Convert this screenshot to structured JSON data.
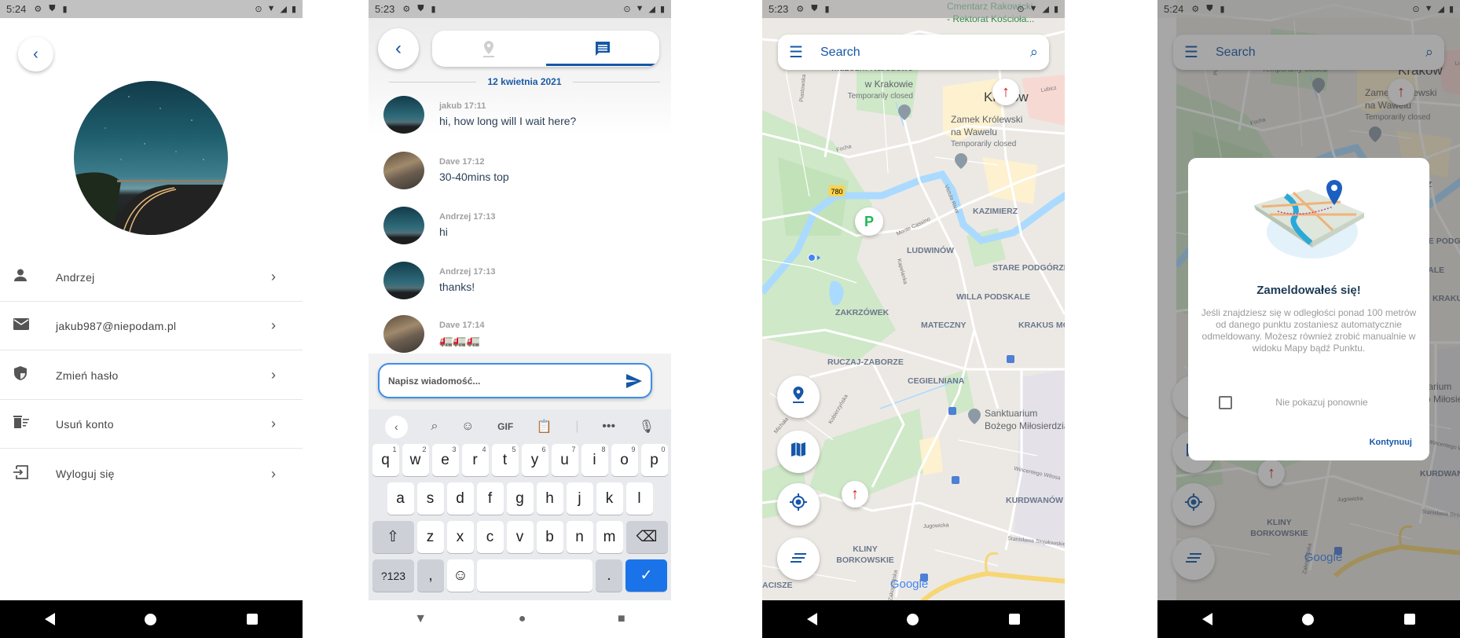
{
  "colors": {
    "accent": "#1557a8",
    "keyboard_enter": "#1a73e8",
    "compass": "#d01c1c",
    "parking": "#1db954"
  },
  "screens": [
    {
      "status": {
        "time": "5:24"
      }
    },
    {
      "status": {
        "time": "5:23"
      }
    },
    {
      "status": {
        "time": "5:23"
      }
    },
    {
      "status": {
        "time": "5:24"
      }
    }
  ],
  "profile": {
    "items": [
      {
        "icon": "person-icon",
        "label": "Andrzej"
      },
      {
        "icon": "email-icon",
        "label": "jakub987@niepodam.pl"
      },
      {
        "icon": "shield-icon",
        "label": "Zmień hasło"
      },
      {
        "icon": "delete-account-icon",
        "label": "Usuń konto"
      },
      {
        "icon": "logout-icon",
        "label": "Wyloguj się"
      }
    ]
  },
  "chat": {
    "tabs": [
      {
        "icon": "location-pin-icon",
        "active": false
      },
      {
        "icon": "chat-icon",
        "active": true
      }
    ],
    "date": "12 kwietnia 2021",
    "messages": [
      {
        "author": "jakub 17:11",
        "text": "hi, how long will I wait here?",
        "avatar": "night"
      },
      {
        "author": "Dave 17:12",
        "text": "30-40mins top",
        "avatar": "room"
      },
      {
        "author": "Andrzej 17:13",
        "text": "hi",
        "avatar": "night"
      },
      {
        "author": "Andrzej 17:13",
        "text": "thanks!",
        "avatar": "night"
      },
      {
        "author": "Dave 17:14",
        "text": "🚛🚛🚛",
        "avatar": "room"
      }
    ],
    "input_placeholder": "Napisz wiadomość...",
    "keyboard": {
      "toolbar": [
        "search-icon",
        "sticker-icon",
        "GIF",
        "clipboard-icon",
        "more-icon",
        "mic-icon"
      ],
      "gif_label": "GIF",
      "row1": [
        "q",
        "w",
        "e",
        "r",
        "t",
        "y",
        "u",
        "i",
        "o",
        "p"
      ],
      "row1_hints": [
        "1",
        "2",
        "3",
        "4",
        "5",
        "6",
        "7",
        "8",
        "9",
        "0"
      ],
      "row2": [
        "a",
        "s",
        "d",
        "f",
        "g",
        "h",
        "j",
        "k",
        "l"
      ],
      "row3": [
        "z",
        "x",
        "c",
        "v",
        "b",
        "n",
        "m"
      ],
      "symbols_label": "?123",
      "comma": ",",
      "period": "."
    }
  },
  "map": {
    "search_placeholder": "Search",
    "route_badge": "780",
    "parking_label": "P",
    "google_label": "Google",
    "labels": [
      {
        "text": "Cmentarz Rakowicki",
        "kind": "poi-green"
      },
      {
        "text": "- Rektorat Kościoła...",
        "kind": "poi-green"
      },
      {
        "text": "Muzeum Narodowe",
        "kind": "poi"
      },
      {
        "text": "w Krakowie",
        "kind": "poi"
      },
      {
        "text": "Temporarily closed",
        "kind": "small"
      },
      {
        "text": "Kraków",
        "kind": "city"
      },
      {
        "text": "Zamek Królewski",
        "kind": "poi"
      },
      {
        "text": "na Wawelu",
        "kind": "poi"
      },
      {
        "text": "Temporarily closed",
        "kind": "small"
      },
      {
        "text": "KAZIMIERZ",
        "kind": "district"
      },
      {
        "text": "LUDWINÓW",
        "kind": "district"
      },
      {
        "text": "STARE PODGÓRZE",
        "kind": "district"
      },
      {
        "text": "WILLA PODSKALE",
        "kind": "district"
      },
      {
        "text": "ZAKRZÓWEK",
        "kind": "district"
      },
      {
        "text": "MATECZNY",
        "kind": "district"
      },
      {
        "text": "KRAKUS MO",
        "kind": "district"
      },
      {
        "text": "RUCZAJ-ZABORZE",
        "kind": "district"
      },
      {
        "text": "CEGIELNIANA",
        "kind": "district"
      },
      {
        "text": "Sanktuarium",
        "kind": "poi"
      },
      {
        "text": "Bożego Miłosierdzia",
        "kind": "poi"
      },
      {
        "text": "KURDWANÓW",
        "kind": "district"
      },
      {
        "text": "KLINY",
        "kind": "district"
      },
      {
        "text": "BORKOWSKIE",
        "kind": "district"
      },
      {
        "text": "ACISZE",
        "kind": "district"
      },
      {
        "text": "Focha",
        "kind": "road"
      },
      {
        "text": "Monte Cassino",
        "kind": "road"
      },
      {
        "text": "Vistula River",
        "kind": "road"
      },
      {
        "text": "Kapelanka",
        "kind": "road"
      },
      {
        "text": "Piastowska",
        "kind": "road"
      },
      {
        "text": "Lubicz",
        "kind": "road"
      },
      {
        "text": "Kobierzyńska",
        "kind": "road"
      },
      {
        "text": "Jugowicka",
        "kind": "road"
      },
      {
        "text": "Wincentego Witosa",
        "kind": "road"
      },
      {
        "text": "Stanisława Stojałowskiego",
        "kind": "road"
      },
      {
        "text": "Zakopiańska",
        "kind": "road"
      },
      {
        "text": "Michała",
        "kind": "road"
      }
    ],
    "fabs": [
      "pin-icon",
      "map-icon",
      "my-location-icon",
      "list-icon"
    ]
  },
  "dialog": {
    "title": "Zameldowałeś się!",
    "body": "Jeśli znajdziesz się w odległości ponad 100 metrów od danego punktu zostaniesz automatycznie odmeldowany. Możesz również zrobić manualnie w widoku Mapy bądź Punktu.",
    "checkbox_label": "Nie pokazuj ponownie",
    "checkbox_checked": false,
    "button": "Kontynuuj"
  }
}
